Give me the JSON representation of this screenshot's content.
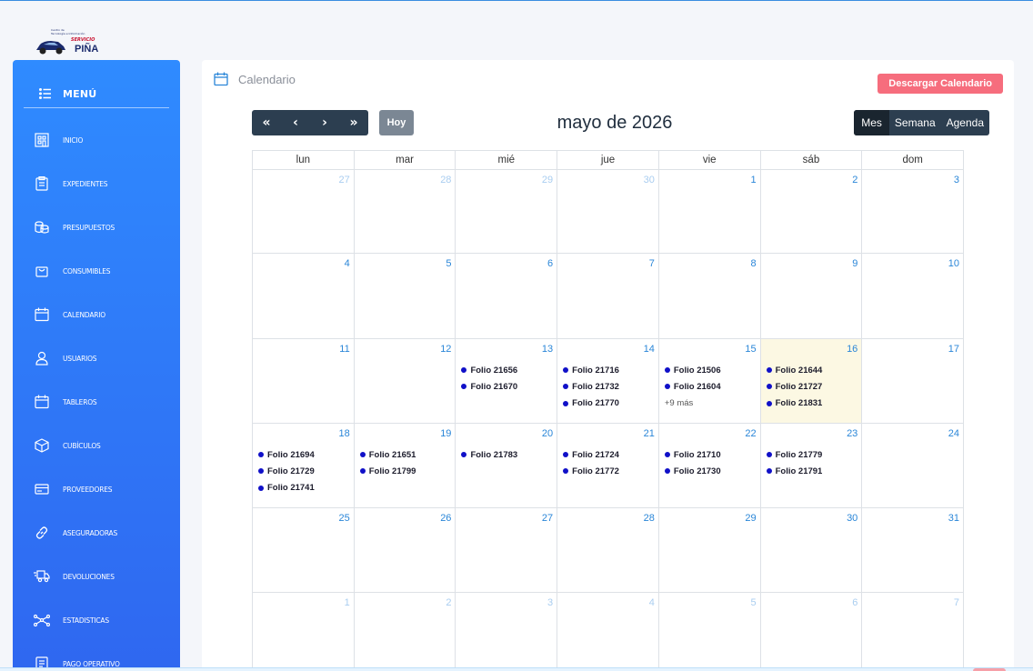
{
  "logo": {
    "line1": "Centro de",
    "line2": "Tecnología e Información",
    "brand": "SERVICIO",
    "name": "PIÑA"
  },
  "sidebar": {
    "title": "MENÚ",
    "items": [
      {
        "label": "INICIO",
        "icon": "building-icon"
      },
      {
        "label": "EXPEDIENTES",
        "icon": "clipboard-icon"
      },
      {
        "label": "PRESUPUESTOS",
        "icon": "coins-icon"
      },
      {
        "label": "CONSUMIBLES",
        "icon": "bag-icon"
      },
      {
        "label": "CALENDARIO",
        "icon": "calendar-icon"
      },
      {
        "label": "USUARIOS",
        "icon": "user-icon"
      },
      {
        "label": "TABLEROS",
        "icon": "board-icon"
      },
      {
        "label": "CUBÍCULOS",
        "icon": "cube-icon"
      },
      {
        "label": "PROVEEDORES",
        "icon": "card-icon"
      },
      {
        "label": "ASEGURADORAS",
        "icon": "link-icon"
      },
      {
        "label": "DEVOLUCIONES",
        "icon": "truck-icon"
      },
      {
        "label": "ESTADISTICAS",
        "icon": "chart-icon"
      },
      {
        "label": "PAGO OPERATIVO",
        "icon": "receipt-icon"
      }
    ]
  },
  "header": {
    "title": "Calendario",
    "download_label": "Descargar Calendario"
  },
  "toolbar": {
    "prev_year": "«",
    "prev": "‹",
    "next": "›",
    "next_year": "»",
    "today_label": "Hoy",
    "month_title": "mayo de 2026",
    "views": [
      "Mes",
      "Semana",
      "Agenda"
    ],
    "active_view": "Mes"
  },
  "calendar": {
    "weekdays": [
      "lun",
      "mar",
      "mié",
      "jue",
      "vie",
      "sáb",
      "dom"
    ],
    "today": "16",
    "weeks": [
      [
        {
          "d": "27",
          "o": true
        },
        {
          "d": "28",
          "o": true
        },
        {
          "d": "29",
          "o": true
        },
        {
          "d": "30",
          "o": true
        },
        {
          "d": "1"
        },
        {
          "d": "2"
        },
        {
          "d": "3"
        }
      ],
      [
        {
          "d": "4"
        },
        {
          "d": "5"
        },
        {
          "d": "6"
        },
        {
          "d": "7"
        },
        {
          "d": "8"
        },
        {
          "d": "9"
        },
        {
          "d": "10"
        }
      ],
      [
        {
          "d": "11"
        },
        {
          "d": "12"
        },
        {
          "d": "13",
          "ev": [
            "Folio 21656",
            "Folio 21670"
          ]
        },
        {
          "d": "14",
          "ev": [
            "Folio 21716",
            "Folio 21732",
            "Folio 21770"
          ]
        },
        {
          "d": "15",
          "ev": [
            "Folio 21506",
            "Folio 21604"
          ],
          "more": "+9 más"
        },
        {
          "d": "16",
          "ev": [
            "Folio 21644",
            "Folio 21727",
            "Folio 21831"
          ],
          "today": true
        },
        {
          "d": "17"
        }
      ],
      [
        {
          "d": "18",
          "ev": [
            "Folio 21694",
            "Folio 21729",
            "Folio 21741"
          ]
        },
        {
          "d": "19",
          "ev": [
            "Folio 21651",
            "Folio 21799"
          ]
        },
        {
          "d": "20",
          "ev": [
            "Folio 21783"
          ]
        },
        {
          "d": "21",
          "ev": [
            "Folio 21724",
            "Folio 21772"
          ]
        },
        {
          "d": "22",
          "ev": [
            "Folio 21710",
            "Folio 21730"
          ]
        },
        {
          "d": "23",
          "ev": [
            "Folio 21779",
            "Folio 21791"
          ]
        },
        {
          "d": "24"
        }
      ],
      [
        {
          "d": "25"
        },
        {
          "d": "26"
        },
        {
          "d": "27"
        },
        {
          "d": "28"
        },
        {
          "d": "29"
        },
        {
          "d": "30"
        },
        {
          "d": "31"
        }
      ],
      [
        {
          "d": "1",
          "o": true
        },
        {
          "d": "2",
          "o": true
        },
        {
          "d": "3",
          "o": true
        },
        {
          "d": "4",
          "o": true
        },
        {
          "d": "5",
          "o": true
        },
        {
          "d": "6",
          "o": true
        },
        {
          "d": "7",
          "o": true
        }
      ]
    ]
  },
  "colors": {
    "sidebar_top": "#2f8bff",
    "sidebar_bottom": "#2f67f0",
    "download": "#f66d7d",
    "toolbar": "#2c3e50",
    "today_bg": "#fcf8e3",
    "event_dot": "#1010c8",
    "day_number": "#2a86d8"
  }
}
